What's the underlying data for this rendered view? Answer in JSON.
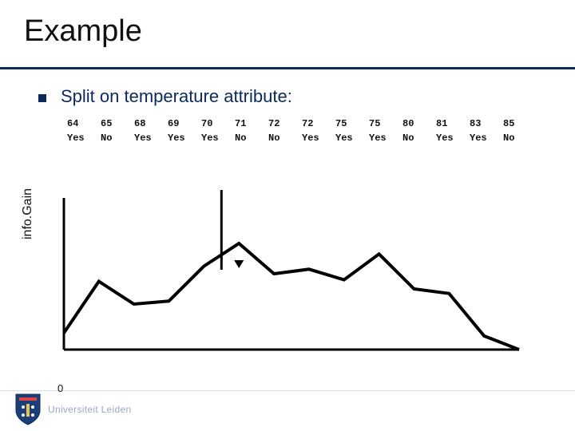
{
  "title": "Example",
  "bullet": "Split on temperature attribute:",
  "table": {
    "temps": [
      "64",
      "65",
      "68",
      "69",
      "70",
      "71",
      "72",
      "72",
      "75",
      "75",
      "80",
      "81",
      "83",
      "85"
    ],
    "labels": [
      "Yes",
      "No",
      "Yes",
      "Yes",
      "Yes",
      "No",
      "No",
      "Yes",
      "Yes",
      "Yes",
      "No",
      "Yes",
      "Yes",
      "No"
    ]
  },
  "ylabel": "info.Gain",
  "page_number": "0",
  "footer_uni": "Universiteit Leiden",
  "chart_data": {
    "type": "line",
    "title": "",
    "xlabel": "",
    "ylabel": "info.Gain",
    "categories": [
      "64",
      "65",
      "68",
      "69",
      "70",
      "71",
      "72",
      "72",
      "75",
      "75",
      "80",
      "81",
      "83",
      "85"
    ],
    "values": [
      0.11,
      0.45,
      0.3,
      0.32,
      0.55,
      0.7,
      0.5,
      0.53,
      0.46,
      0.63,
      0.4,
      0.37,
      0.09,
      0.0
    ],
    "ylim": [
      0,
      1
    ],
    "grid": false,
    "legend": false,
    "annotations": [
      {
        "text": "split marker",
        "x_between": [
          "70",
          "71"
        ],
        "kind": "vline"
      },
      {
        "text": "arrow",
        "at": "71",
        "kind": "down-arrow"
      }
    ]
  }
}
